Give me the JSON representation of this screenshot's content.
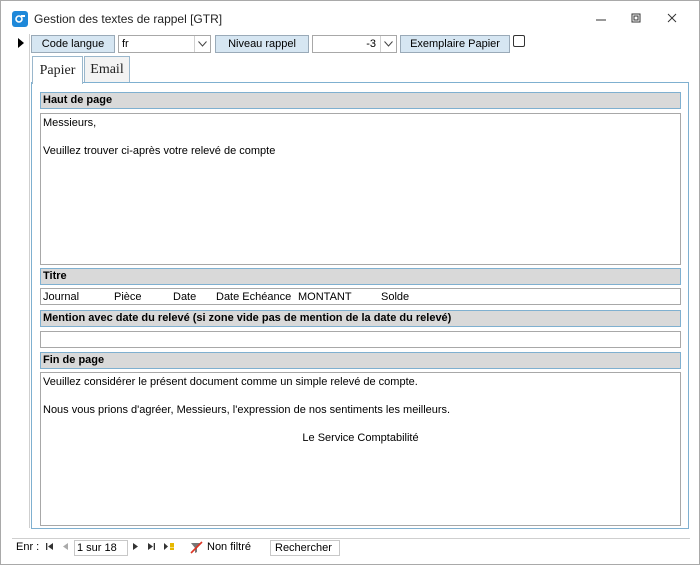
{
  "window": {
    "title": "Gestion des textes de rappel [GTR]"
  },
  "header": {
    "code_langue_label": "Code langue",
    "code_langue_value": "fr",
    "niveau_rappel_label": "Niveau rappel",
    "niveau_rappel_value": "-3",
    "exemplaire_papier_label": "Exemplaire Papier",
    "exemplaire_papier_checked": false
  },
  "tabs": [
    {
      "label": "Papier",
      "active": true
    },
    {
      "label": "Email",
      "active": false
    }
  ],
  "sections": {
    "haut_de_page": {
      "label": "Haut de page",
      "lines": [
        "Messieurs,",
        "",
        "Veuillez trouver ci-après votre relevé de compte"
      ]
    },
    "titre": {
      "label": "Titre",
      "columns": [
        "Journal",
        "Pièce",
        "Date",
        "Date Echéance",
        "MONTANT",
        "Solde"
      ]
    },
    "mention": {
      "label": "Mention avec date du relevé (si zone vide pas de mention de la date du relevé)",
      "value": ""
    },
    "fin_de_page": {
      "label": "Fin de page",
      "lines": [
        "Veuillez considérer le présent document comme un simple relevé de compte.",
        "",
        "Nous vous prions d'agréer, Messieurs, l'expression de nos sentiments les meilleurs.",
        "",
        "Le Service Comptabilité"
      ]
    }
  },
  "navigation": {
    "record_label": "Enr :",
    "record_position": "1 sur 18",
    "filter_status": "Non filtré",
    "search_label": "Rechercher"
  },
  "colors": {
    "accent": "#1e88d9",
    "label_button_bg": "#d6e6f2",
    "section_header_bg": "#d9d9d9",
    "panel_border": "#7fb0d0"
  }
}
